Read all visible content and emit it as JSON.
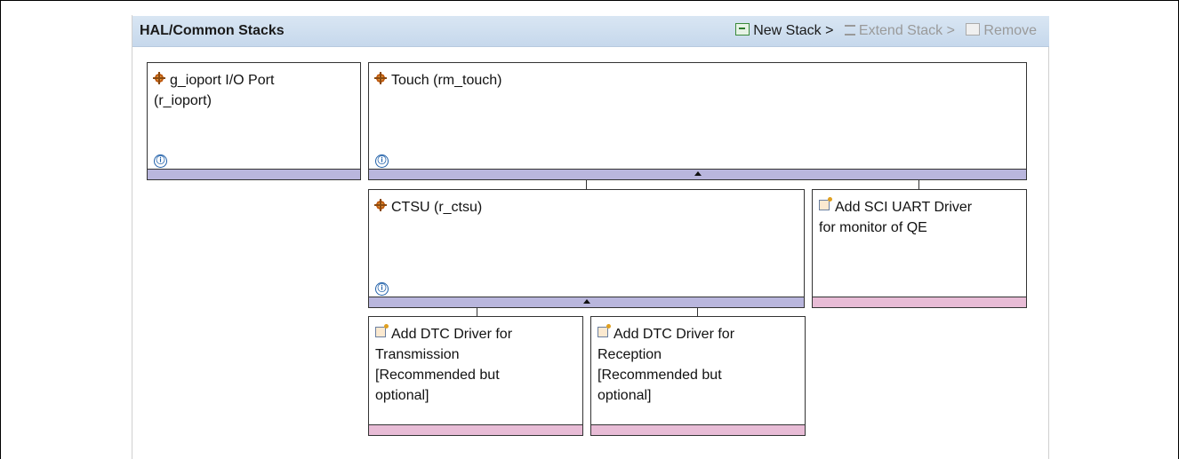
{
  "header": {
    "title": "HAL/Common Stacks",
    "actions": {
      "new_stack": "New Stack >",
      "extend_stack": "Extend Stack >",
      "remove": "Remove"
    }
  },
  "modules": {
    "ioport": {
      "label": "g_ioport I/O Port\n(r_ioport)",
      "icon": "module-icon",
      "info": "ⓘ"
    },
    "touch": {
      "label": "Touch (rm_touch)",
      "icon": "module-icon",
      "info": "ⓘ"
    },
    "ctsu": {
      "label": "CTSU (r_ctsu)",
      "icon": "module-icon",
      "info": "ⓘ"
    },
    "sci_uart": {
      "label": "Add SCI UART Driver\nfor monitor of QE",
      "icon": "add-module-icon"
    },
    "dtc_tx": {
      "label": "Add DTC Driver for\nTransmission\n[Recommended but\noptional]",
      "icon": "add-module-icon"
    },
    "dtc_rx": {
      "label": "Add DTC Driver for\nReception\n[Recommended but\noptional]",
      "icon": "add-module-icon"
    }
  },
  "colors": {
    "header_bg": "#c6d8ec",
    "implemented_bar": "#b9b6dd",
    "optional_bar": "#e8bcd6"
  }
}
